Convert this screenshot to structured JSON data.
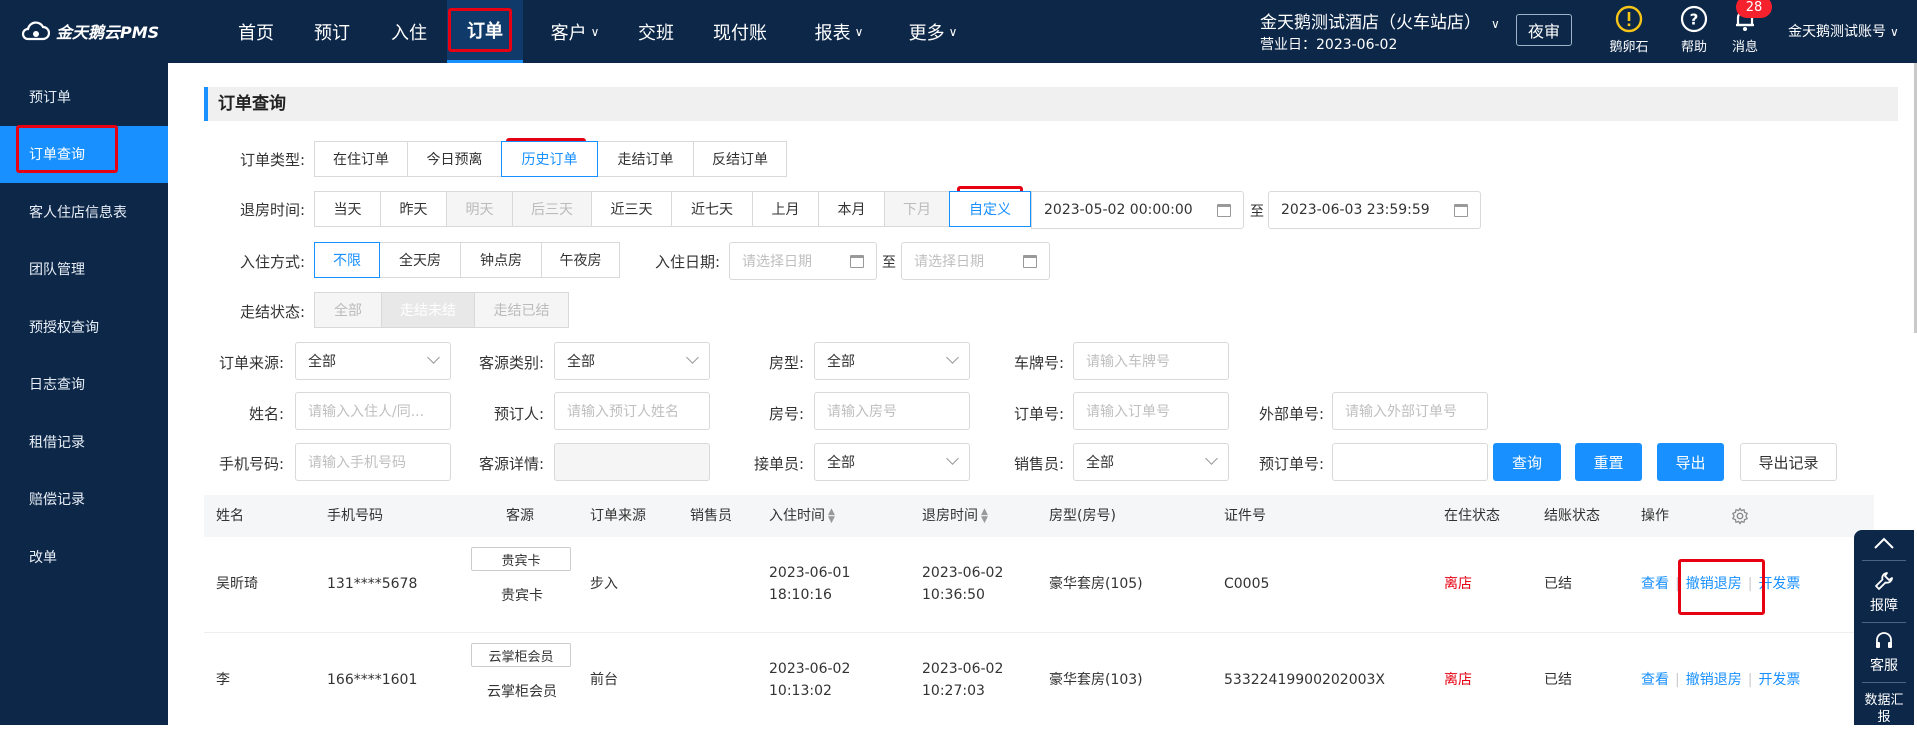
{
  "app": {
    "name": "金天鹅云PMS"
  },
  "nav": [
    {
      "label": "首页",
      "chevron": false
    },
    {
      "label": "预订",
      "chevron": false
    },
    {
      "label": "入住",
      "chevron": false
    },
    {
      "label": "订单",
      "chevron": false,
      "active": true
    },
    {
      "label": "客户",
      "chevron": true
    },
    {
      "label": "交班",
      "chevron": false
    },
    {
      "label": "现付账",
      "chevron": false
    },
    {
      "label": "报表",
      "chevron": true
    },
    {
      "label": "更多",
      "chevron": true
    }
  ],
  "header": {
    "hotel": "金天鹅测试酒店（火车站店）",
    "business_day": "营业日：2023-06-02",
    "night_audit": "夜审",
    "egg_stone": "鹅卵石",
    "help": "帮助",
    "messages": "消息",
    "message_count": "28",
    "account": "金天鹅测试账号"
  },
  "sidebar": {
    "items": [
      {
        "label": "预订单"
      },
      {
        "label": "订单查询",
        "active": true
      },
      {
        "label": "客人住店信息表"
      },
      {
        "label": "团队管理"
      },
      {
        "label": "预授权查询"
      },
      {
        "label": "日志查询"
      },
      {
        "label": "租借记录"
      },
      {
        "label": "赔偿记录"
      },
      {
        "label": "改单"
      }
    ]
  },
  "page": {
    "title": "订单查询"
  },
  "filters": {
    "order_type": {
      "label": "订单类型:",
      "options": [
        "在住订单",
        "今日预离",
        "历史订单",
        "走结订单",
        "反结订单"
      ],
      "selected": "历史订单"
    },
    "checkout_time": {
      "label": "退房时间:",
      "options": [
        "当天",
        "昨天",
        "明天",
        "后三天",
        "近三天",
        "近七天",
        "上月",
        "本月",
        "下月",
        "自定义"
      ],
      "selected": "自定义",
      "start": "2023-05-02 00:00:00",
      "to": "至",
      "end": "2023-06-03 23:59:59"
    },
    "checkin_method": {
      "label": "入住方式:",
      "options": [
        "不限",
        "全天房",
        "钟点房",
        "午夜房"
      ],
      "selected": "不限"
    },
    "checkin_date": {
      "label": "入住日期:",
      "placeholder_start": "请选择日期",
      "to": "至",
      "placeholder_end": "请选择日期"
    },
    "settle_status": {
      "label": "走结状态:",
      "options": [
        "全部",
        "走结未结",
        "走结已结"
      ]
    },
    "order_source": {
      "label": "订单来源:",
      "value": "全部"
    },
    "guest_category": {
      "label": "客源类别:",
      "value": "全部"
    },
    "room_type": {
      "label": "房型:",
      "value": "全部"
    },
    "plate": {
      "label": "车牌号:",
      "placeholder": "请输入车牌号"
    },
    "name": {
      "label": "姓名:",
      "placeholder": "请输入入住人/同..."
    },
    "booker": {
      "label": "预订人:",
      "placeholder": "请输入预订人姓名"
    },
    "room_no": {
      "label": "房号:",
      "placeholder": "请输入房号"
    },
    "order_no": {
      "label": "订单号:",
      "placeholder": "请输入订单号"
    },
    "external_no": {
      "label": "外部单号:",
      "placeholder": "请输入外部订单号"
    },
    "phone": {
      "label": "手机号码:",
      "placeholder": "请输入手机号码"
    },
    "guest_detail": {
      "label": "客源详情:"
    },
    "receptionist": {
      "label": "接单员:",
      "value": "全部"
    },
    "salesperson": {
      "label": "销售员:",
      "value": "全部"
    },
    "booking_no": {
      "label": "预订单号:"
    }
  },
  "actions": {
    "search": "查询",
    "reset": "重置",
    "export": "导出",
    "export_log": "导出记录"
  },
  "table": {
    "headers": [
      "姓名",
      "手机号码",
      "客源",
      "订单来源",
      "销售员",
      "入住时间",
      "退房时间",
      "房型(房号)",
      "证件号",
      "在住状态",
      "结账状态",
      "操作"
    ],
    "rows": [
      {
        "name": "吴昕琦",
        "phone": "131****5678",
        "source_tag": "贵宾卡",
        "source": "贵宾卡",
        "order_source": "步入",
        "salesperson": "",
        "checkin_date": "2023-06-01",
        "checkin_time": "18:10:16",
        "checkout_date": "2023-06-02",
        "checkout_time": "10:36:50",
        "room": "豪华套房(105)",
        "id_no": "C0005",
        "stay_status": "离店",
        "settle_status": "已结",
        "ops": [
          "查看",
          "撤销退房",
          "开发票"
        ]
      },
      {
        "name": "李",
        "phone": "166****1601",
        "source_tag": "云掌柜会员",
        "source": "云掌柜会员",
        "order_source": "前台",
        "salesperson": "",
        "checkin_date": "2023-06-02",
        "checkin_time": "10:13:02",
        "checkout_date": "2023-06-02",
        "checkout_time": "10:27:03",
        "room": "豪华套房(103)",
        "id_no": "53322419900202003X",
        "stay_status": "离店",
        "settle_status": "已结",
        "ops": [
          "查看",
          "撤销退房",
          "开发票"
        ]
      }
    ]
  },
  "floatbar": {
    "report": "报障",
    "service": "客服",
    "data": "数据汇报"
  }
}
